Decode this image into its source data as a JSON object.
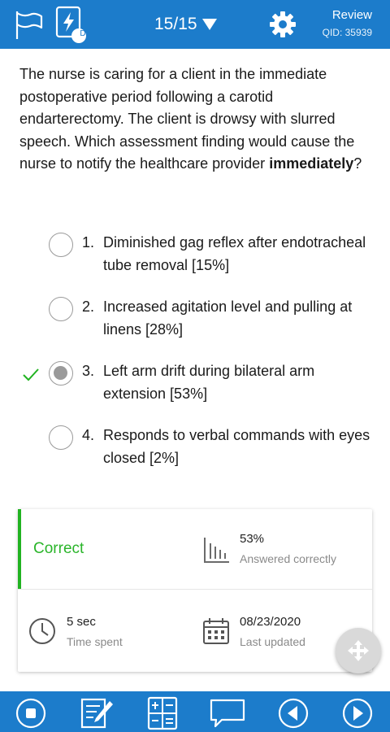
{
  "header": {
    "counter": "15/15",
    "review_label": "Review",
    "qid": "QID: 35939",
    "flashcard_badge": "D"
  },
  "question": {
    "text_before": "The nurse is caring for a client in the immediate postoperative period following a carotid endarterectomy.  The client is drowsy with slurred speech.  Which assessment finding would cause the nurse to notify the healthcare provider ",
    "bold": "immediately",
    "text_after": "?"
  },
  "options": [
    {
      "num": "1.",
      "text": "Diminished gag reflex after endotracheal tube removal [15%]",
      "selected": false,
      "correct": false
    },
    {
      "num": "2.",
      "text": "Increased agitation level and pulling at linens [28%]",
      "selected": false,
      "correct": false
    },
    {
      "num": "3.",
      "text": "Left arm drift during bilateral arm extension [53%]",
      "selected": true,
      "correct": true
    },
    {
      "num": "4.",
      "text": "Responds to verbal commands with eyes closed [2%]",
      "selected": false,
      "correct": false
    }
  ],
  "stats": {
    "result": "Correct",
    "percent": "53%",
    "percent_label": "Answered correctly",
    "time": "5 sec",
    "time_label": "Time spent",
    "date": "08/23/2020",
    "date_label": "Last updated"
  },
  "colors": {
    "primary": "#1c7ccb",
    "correct_green": "#21b321",
    "radio_gray": "#9a9a9a"
  },
  "icons": {
    "top": [
      "flag-icon",
      "flashcard-icon",
      "dropdown-triangle-icon",
      "gear-icon"
    ],
    "bottom": [
      "stop-icon",
      "notes-icon",
      "calculator-icon",
      "feedback-icon",
      "previous-icon",
      "next-icon"
    ],
    "stats": [
      "bar-chart-icon",
      "clock-icon",
      "calendar-icon"
    ],
    "fab": "move-icon"
  }
}
